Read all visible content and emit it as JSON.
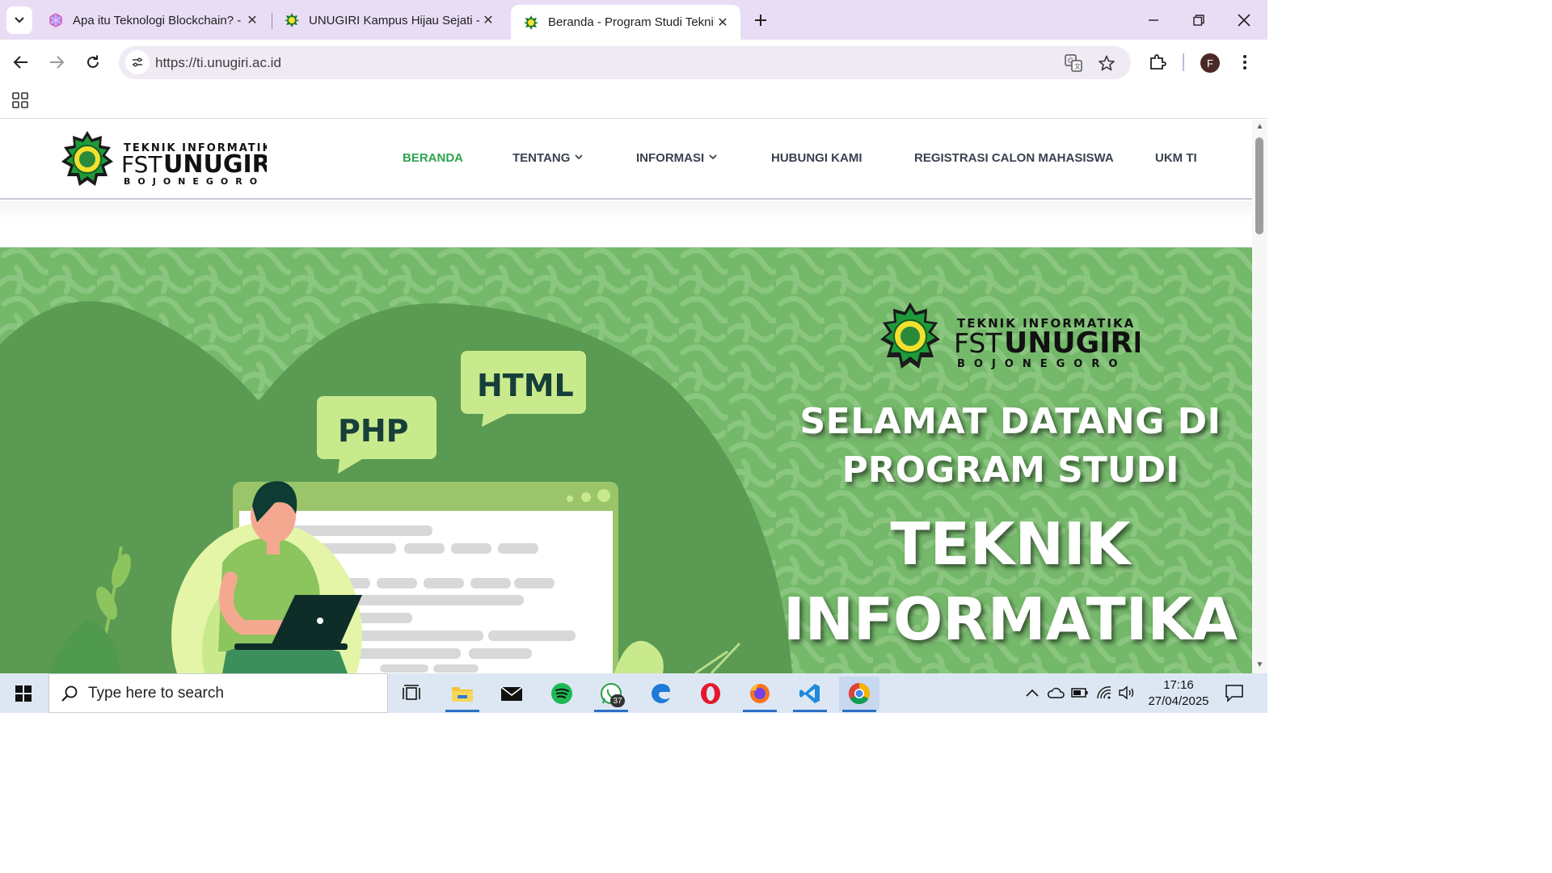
{
  "browser": {
    "tabs": [
      {
        "title": "Apa itu Teknologi Blockchain? -",
        "favicon": "cube-icon",
        "active": false
      },
      {
        "title": "UNUGIRI Kampus Hijau Sejati -",
        "favicon": "unugiri-logo-icon",
        "active": false
      },
      {
        "title": "Beranda - Program Studi Teknik",
        "favicon": "unugiri-logo-icon",
        "active": true
      }
    ],
    "url": "https://ti.unugiri.ac.id",
    "profile_initial": "F"
  },
  "site": {
    "logo": {
      "line1": "TEKNIK INFORMATIKA",
      "line2_a": "FST",
      "line2_b": "UNUGIRI",
      "line3": "BOJONEGORO"
    },
    "nav": [
      {
        "label": "BERANDA",
        "active": true,
        "dropdown": false
      },
      {
        "label": "TENTANG",
        "active": false,
        "dropdown": true
      },
      {
        "label": "INFORMASI",
        "active": false,
        "dropdown": true
      },
      {
        "label": "HUBUNGI KAMI",
        "active": false,
        "dropdown": false
      },
      {
        "label": "REGISTRASI CALON MAHASISWA",
        "active": false,
        "dropdown": false
      },
      {
        "label": "UKM TI",
        "active": false,
        "dropdown": false
      }
    ],
    "hero": {
      "bubble_php": "PHP",
      "bubble_html": "HTML",
      "line1": "SELAMAT DATANG DI",
      "line2": "PROGRAM STUDI",
      "line3": "TEKNIK",
      "line4": "INFORMATIKA",
      "colors": {
        "bg": "#74b86a",
        "hill": "#5a9a52",
        "bubble": "#c9ea8c",
        "accent_green": "#2ea44f"
      }
    }
  },
  "taskbar": {
    "search_placeholder": "Type here to search",
    "whatsapp_badge": "37",
    "time": "17:16",
    "date": "27/04/2025"
  }
}
